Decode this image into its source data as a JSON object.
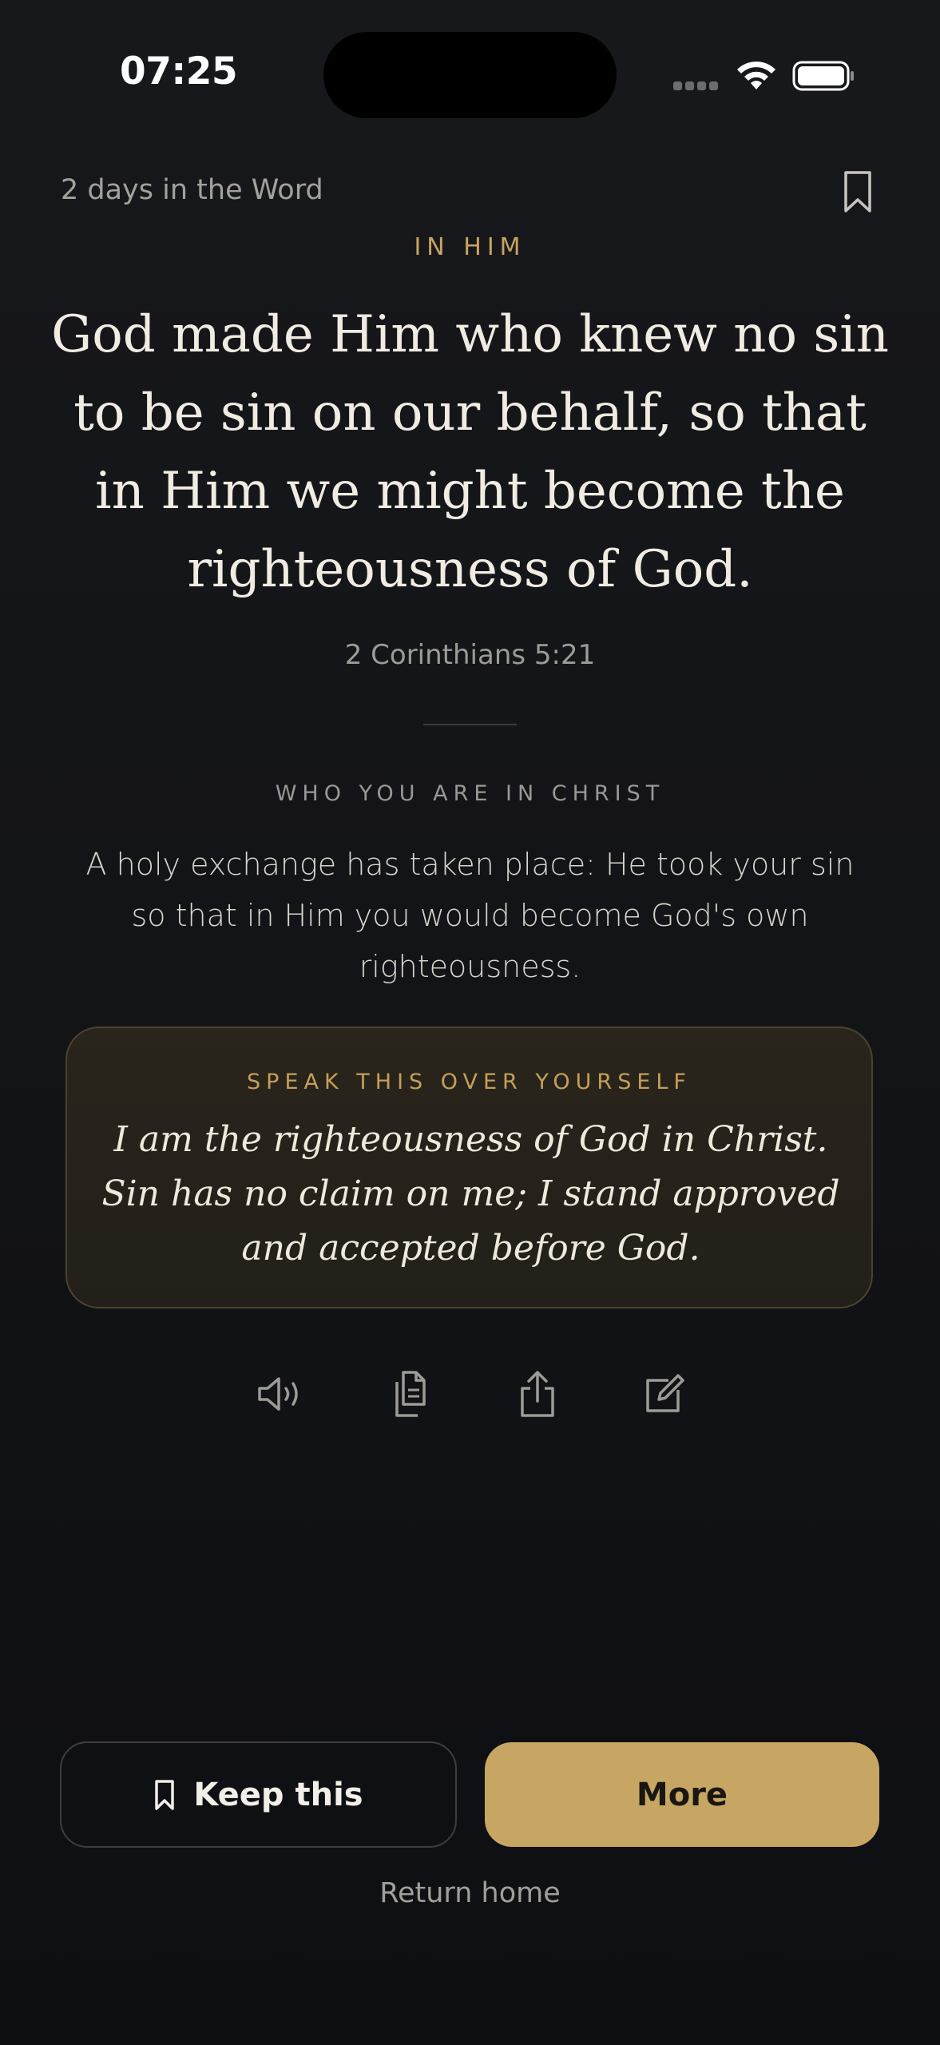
{
  "status_bar": {
    "time": "07:25",
    "icons": [
      "signal-icon",
      "wifi-icon",
      "battery-icon"
    ]
  },
  "header": {
    "streak": "2 days in the Word",
    "bookmark_icon": "bookmark-icon"
  },
  "verse": {
    "eyebrow": "IN HIM",
    "text": "God made Him who knew no sin to be sin on our behalf, so that in Him we might become the righteousness of God.",
    "reference": "2 Corinthians 5:21"
  },
  "identity": {
    "label": "WHO YOU ARE IN CHRIST",
    "text": "A holy exchange has taken place: He took your sin so that in Him you would become God's own righteousness."
  },
  "declaration": {
    "label": "SPEAK THIS OVER YOURSELF",
    "text": "I am the righteousness of God in Christ. Sin has no claim on me; I stand approved and accepted before God."
  },
  "actions": [
    "speaker-icon",
    "copy-icon",
    "share-icon",
    "edit-icon"
  ],
  "buttons": {
    "keep": "Keep this",
    "more": "More",
    "return_home": "Return home"
  },
  "colors": {
    "background": "#131417",
    "accent_gold": "#c7a663",
    "eyebrow_gold": "#c9a35e",
    "card_background": "#26221b"
  }
}
